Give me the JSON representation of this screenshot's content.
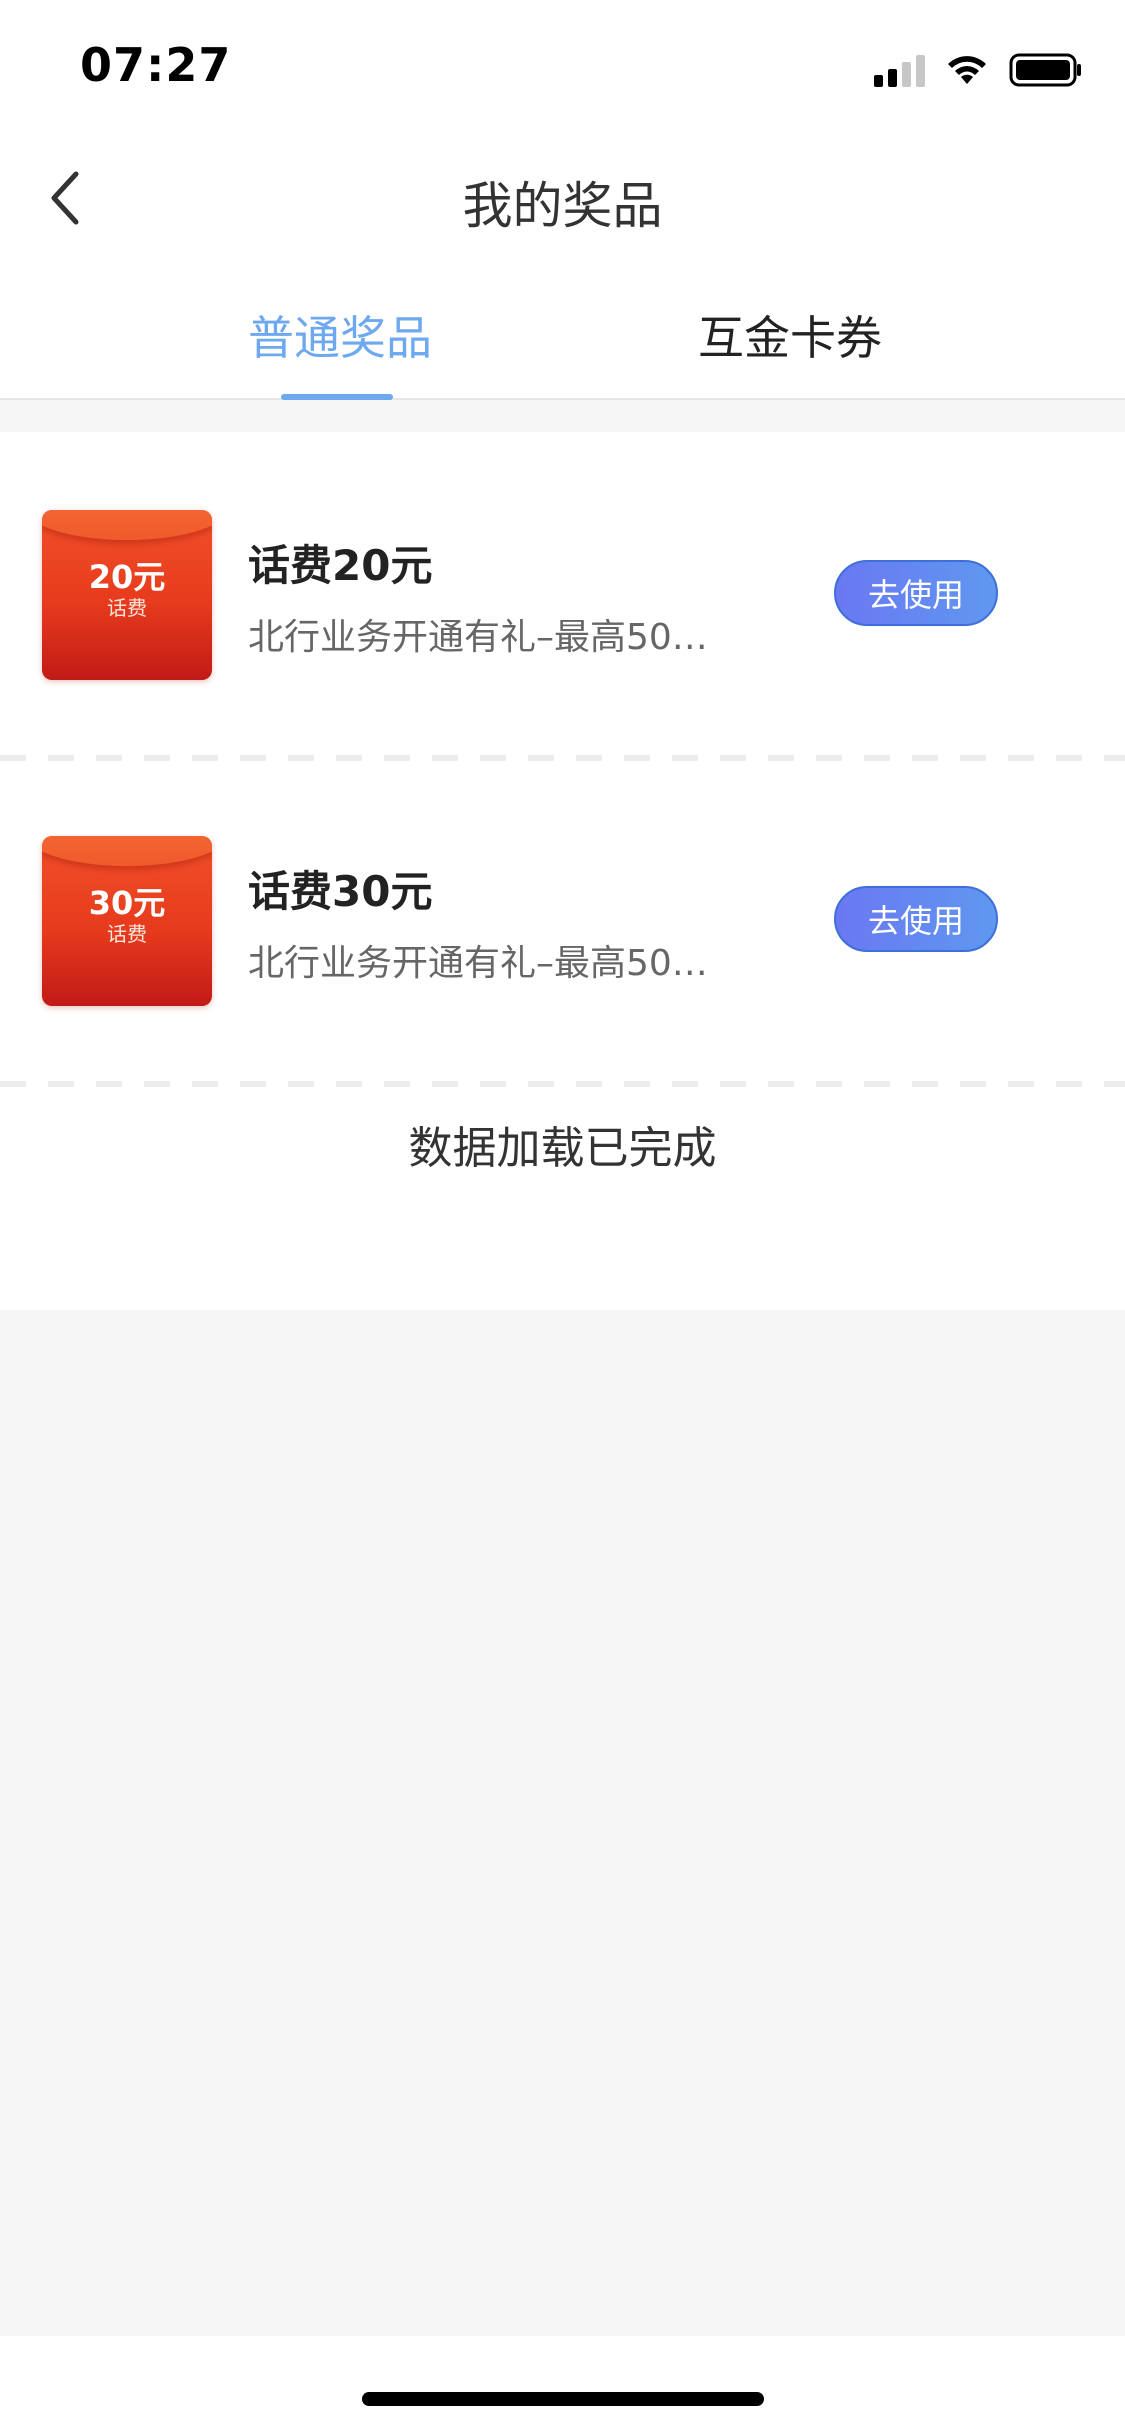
{
  "status_bar": {
    "time": "07:27"
  },
  "nav": {
    "title": "我的奖品"
  },
  "tabs": [
    {
      "label": "普通奖品",
      "active": true
    },
    {
      "label": "互金卡券",
      "active": false
    }
  ],
  "prizes": [
    {
      "thumb_amount": "20元",
      "thumb_label": "话费",
      "title": "话费20元",
      "description": "北行业务开通有礼–最高50…",
      "action": "去使用"
    },
    {
      "thumb_amount": "30元",
      "thumb_label": "话费",
      "title": "话费30元",
      "description": "北行业务开通有礼–最高50…",
      "action": "去使用"
    }
  ],
  "footer_text": "数据加载已完成",
  "colors": {
    "accent": "#6ea8ee",
    "button_start": "#6a78f2",
    "button_end": "#5f98f0",
    "thumb_red": "#e63b1d"
  }
}
